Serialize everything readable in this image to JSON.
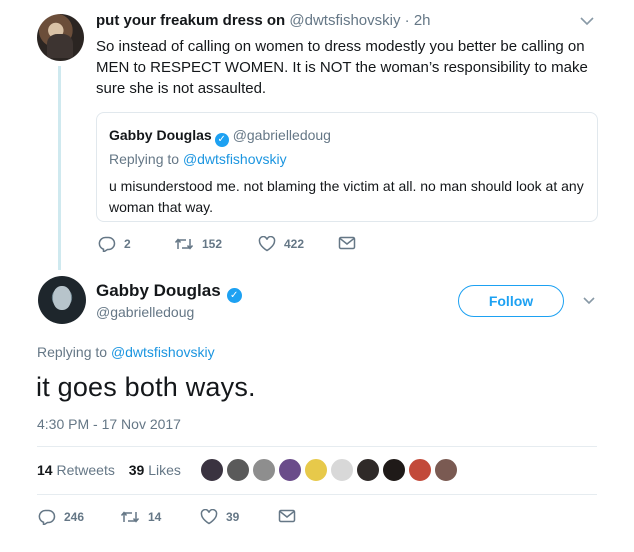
{
  "reply_tweet": {
    "author_name": "put your freakum dress on",
    "author_handle": "@dwtsfishovskiy",
    "separator": "·",
    "time": "2h",
    "text": "So instead of calling on women to dress modestly you better be calling on MEN to RESPECT WOMEN. It is NOT the woman’s responsibility to make sure she is not assaulted.",
    "quoted": {
      "author_name": "Gabby Douglas",
      "verified_glyph": "✓",
      "author_handle": "@gabrielledoug",
      "replying_prefix": "Replying to",
      "replying_handle": "@dwtsfishovskiy",
      "text": "u misunderstood me. not blaming the victim at all. no man should look at any woman that way."
    },
    "actions": {
      "reply_count": "2",
      "retweet_count": "152",
      "like_count": "422"
    }
  },
  "main_tweet": {
    "author_name": "Gabby Douglas",
    "verified_glyph": "✓",
    "author_handle": "@gabrielledoug",
    "follow_label": "Follow",
    "replying_prefix": "Replying to",
    "replying_handle": "@dwtsfishovskiy",
    "text": "it goes both ways.",
    "timestamp": "4:30 PM - 17 Nov 2017",
    "stats": {
      "retweets_count": "14",
      "retweets_label": "Retweets",
      "likes_count": "39",
      "likes_label": "Likes"
    },
    "liker_avatar_colors": [
      "#3a3340",
      "#5a5a5a",
      "#8e8e8e",
      "#6a4c8a",
      "#e7c94a",
      "#d8d8d8",
      "#2f2a28",
      "#1f1a18",
      "#c24a3a",
      "#7a5a52"
    ],
    "actions": {
      "reply_count": "246",
      "retweet_count": "14",
      "like_count": "39"
    }
  },
  "colors": {
    "accent": "#1da1f2",
    "link": "#1b95e0",
    "muted": "#657786",
    "thread_line": "#cfe9ef"
  }
}
